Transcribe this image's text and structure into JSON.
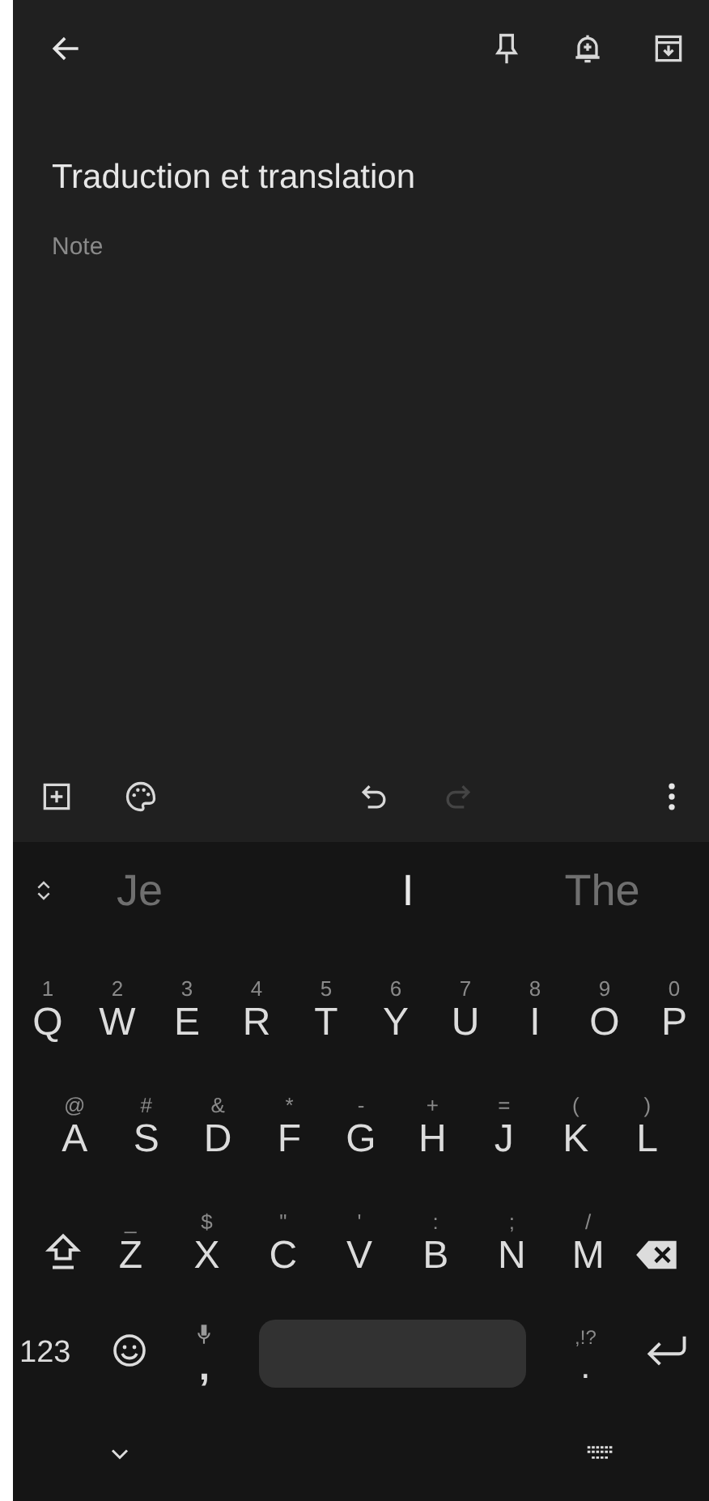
{
  "note": {
    "title": "Traduction et translation",
    "placeholder": "Note"
  },
  "toolbar": {
    "undo_disabled": false,
    "redo_disabled": true
  },
  "suggestions": [
    {
      "text": "Je",
      "highlighted": false
    },
    {
      "text": "I",
      "highlighted": true
    },
    {
      "text": "The",
      "highlighted": false
    }
  ],
  "keyboard": {
    "rows": [
      [
        {
          "label": "Q",
          "hint": "1"
        },
        {
          "label": "W",
          "hint": "2"
        },
        {
          "label": "E",
          "hint": "3"
        },
        {
          "label": "R",
          "hint": "4"
        },
        {
          "label": "T",
          "hint": "5"
        },
        {
          "label": "Y",
          "hint": "6"
        },
        {
          "label": "U",
          "hint": "7"
        },
        {
          "label": "I",
          "hint": "8"
        },
        {
          "label": "O",
          "hint": "9"
        },
        {
          "label": "P",
          "hint": "0"
        }
      ],
      [
        {
          "label": "A",
          "hint": "@"
        },
        {
          "label": "S",
          "hint": "#"
        },
        {
          "label": "D",
          "hint": "&"
        },
        {
          "label": "F",
          "hint": "*"
        },
        {
          "label": "G",
          "hint": "-"
        },
        {
          "label": "H",
          "hint": "+"
        },
        {
          "label": "J",
          "hint": "="
        },
        {
          "label": "K",
          "hint": "("
        },
        {
          "label": "L",
          "hint": ")"
        }
      ],
      [
        {
          "label": "Z",
          "hint": "_"
        },
        {
          "label": "X",
          "hint": "$"
        },
        {
          "label": "C",
          "hint": "\""
        },
        {
          "label": "V",
          "hint": "'"
        },
        {
          "label": "B",
          "hint": ":"
        },
        {
          "label": "N",
          "hint": ";"
        },
        {
          "label": "M",
          "hint": "/"
        }
      ]
    ],
    "symbols_key": "123",
    "comma_key": ",",
    "period_key": ".",
    "period_hint": ",!?"
  }
}
